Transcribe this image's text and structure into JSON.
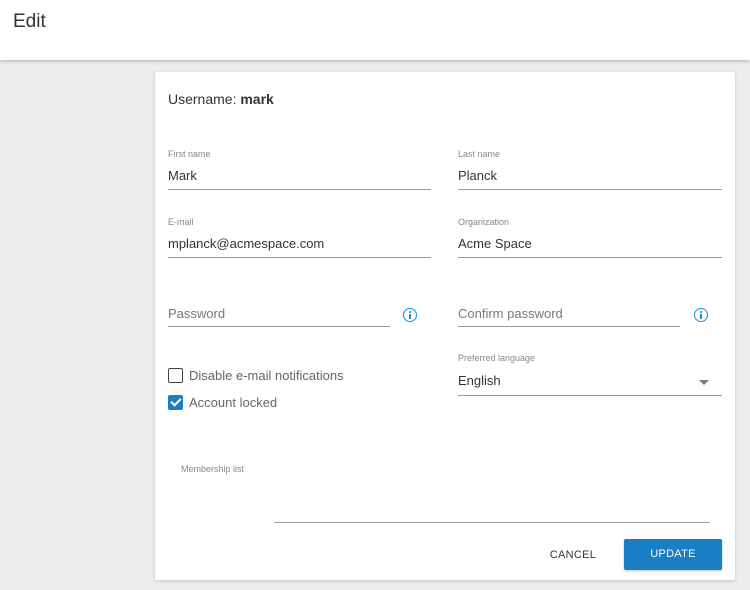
{
  "header": {
    "title": "Edit"
  },
  "form": {
    "username_prefix": "Username:",
    "username": "mark",
    "first_name": {
      "label": "First name",
      "value": "Mark"
    },
    "last_name": {
      "label": "Last name",
      "value": "Planck"
    },
    "email": {
      "label": "E-mail",
      "value": "mplanck@acmespace.com"
    },
    "organization": {
      "label": "Organization",
      "value": "Acme Space"
    },
    "password": {
      "placeholder": "Password"
    },
    "confirm_password": {
      "placeholder": "Confirm password"
    },
    "disable_notifications": {
      "label": "Disable e-mail notifications",
      "checked": false
    },
    "account_locked": {
      "label": "Account locked",
      "checked": true
    },
    "preferred_language": {
      "label": "Preferred language",
      "value": "English"
    },
    "membership_list": {
      "label": "Membership list"
    }
  },
  "actions": {
    "cancel_label": "CANCEL",
    "update_label": "UPDATE"
  },
  "colors": {
    "accent": "#1a7ec5",
    "info_icon": "#1a8fd8"
  },
  "icons": {
    "password_info": "info-icon",
    "confirm_info": "info-icon",
    "language_dropdown": "caret-down-icon",
    "checkbox_checked": "checkmark-icon"
  }
}
